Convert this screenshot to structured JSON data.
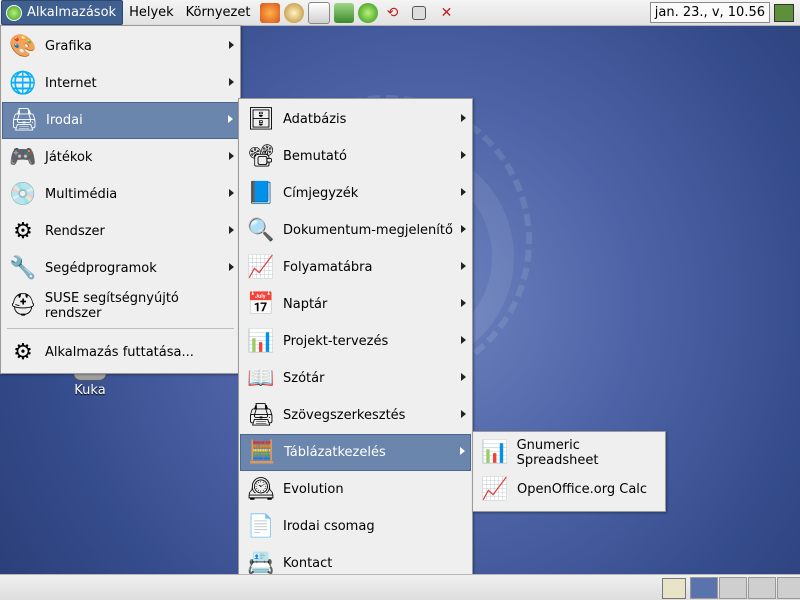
{
  "top_panel": {
    "apps_menu_label": "Alkalmazások",
    "places_label": "Helyek",
    "desktop_label": "Környezet",
    "clock": "jan. 23., v, 10.56"
  },
  "desktop": {
    "trash_label": "Kuka"
  },
  "apps_menu": {
    "items": [
      {
        "label": "Grafika",
        "icon": "graphics-icon"
      },
      {
        "label": "Internet",
        "icon": "internet-icon"
      },
      {
        "label": "Irodai",
        "icon": "office-icon"
      },
      {
        "label": "Játékok",
        "icon": "games-icon"
      },
      {
        "label": "Multimédia",
        "icon": "multimedia-icon"
      },
      {
        "label": "Rendszer",
        "icon": "system-icon"
      },
      {
        "label": "Segédprogramok",
        "icon": "utilities-icon"
      },
      {
        "label": "SUSE segítségnyújtó rendszer",
        "icon": "suse-help-icon"
      },
      {
        "label": "Alkalmazás futtatása...",
        "icon": "run-icon"
      }
    ]
  },
  "office_menu": {
    "items": [
      {
        "label": "Adatbázis",
        "icon": "database-icon"
      },
      {
        "label": "Bemutató",
        "icon": "presentation-icon"
      },
      {
        "label": "Címjegyzék",
        "icon": "address-book-icon"
      },
      {
        "label": "Dokumentum-megjelenítő",
        "icon": "document-viewer-icon"
      },
      {
        "label": "Folyamatábra",
        "icon": "flowchart-icon"
      },
      {
        "label": "Naptár",
        "icon": "calendar-icon"
      },
      {
        "label": "Projekt-tervezés",
        "icon": "project-icon"
      },
      {
        "label": "Szótár",
        "icon": "dictionary-icon"
      },
      {
        "label": "Szövegszerkesztés",
        "icon": "word-processor-icon"
      },
      {
        "label": "Táblázatkezelés",
        "icon": "spreadsheet-icon"
      },
      {
        "label": "Evolution",
        "icon": "evolution-icon"
      },
      {
        "label": "Irodai csomag",
        "icon": "office-suite-icon"
      },
      {
        "label": "Kontact",
        "icon": "kontact-icon"
      }
    ]
  },
  "spreadsheet_menu": {
    "items": [
      {
        "label": "Gnumeric Spreadsheet",
        "icon": "gnumeric-icon"
      },
      {
        "label": "OpenOffice.org Calc",
        "icon": "oocalc-icon"
      }
    ]
  }
}
